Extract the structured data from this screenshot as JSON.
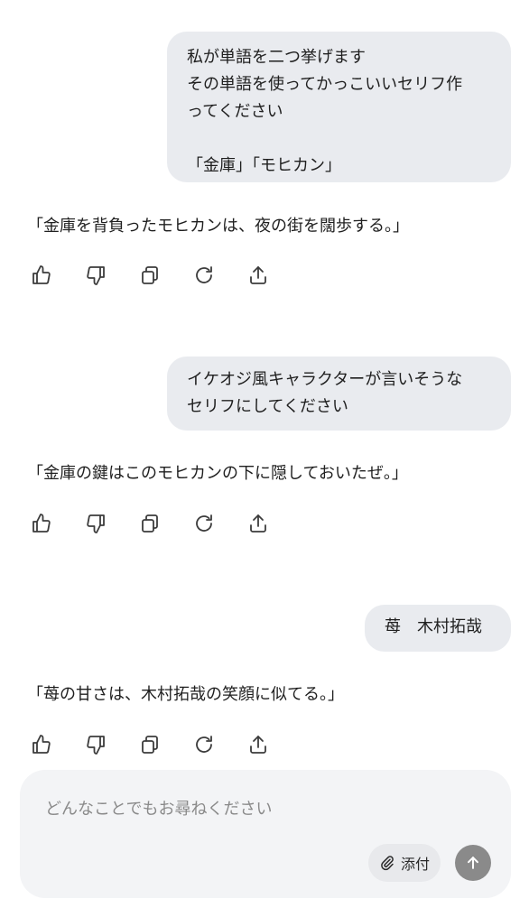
{
  "messages": [
    {
      "user_lines": [
        "私が単語を二つ挙げます",
        "その単語を使ってかっこいいセリフ作",
        "ってください",
        "",
        "「金庫」「モヒカン」"
      ],
      "assistant": "「金庫を背負ったモヒカンは、夜の街を闊歩する。」"
    },
    {
      "user_lines": [
        "イケオジ風キャラクターが言いそうな",
        "セリフにしてください"
      ],
      "assistant": "「金庫の鍵はこのモヒカンの下に隠しておいたぜ。」"
    },
    {
      "user_lines": [
        "苺　木村拓哉"
      ],
      "assistant": "「苺の甘さは、木村拓哉の笑顔に似てる。」"
    }
  ],
  "actions": [
    "thumbs-up-icon",
    "thumbs-down-icon",
    "copy-icon",
    "regenerate-icon",
    "share-icon"
  ],
  "composer": {
    "placeholder": "どんなことでもお尋ねください",
    "attach_label": "添付"
  },
  "colors": {
    "user_bubble": "#e9ebef",
    "composer_bg": "#f3f4f6",
    "send_button": "#8a8a8a"
  }
}
